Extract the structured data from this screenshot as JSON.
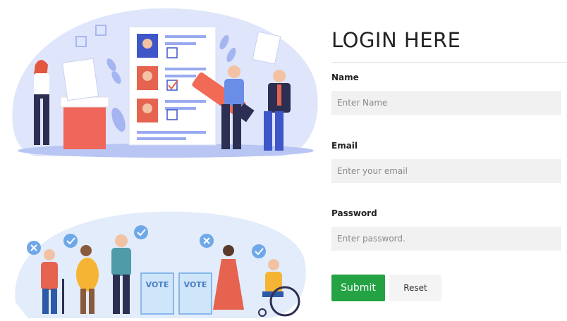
{
  "login": {
    "title": "LOGIN HERE",
    "name_label": "Name",
    "name_placeholder": "Enter Name",
    "email_label": "Email",
    "email_placeholder": "Enter your email",
    "password_label": "Password",
    "password_placeholder": "Enter password.",
    "submit_label": "Submit",
    "reset_label": "Reset"
  },
  "illustration": {
    "vote_box_1": "VOTE",
    "vote_box_2": "VOTE"
  },
  "colors": {
    "accent_green": "#24a244",
    "input_bg": "#f1f1f1",
    "blob_blue": "#dfe6fb",
    "ballot_box_red": "#f0665a"
  }
}
